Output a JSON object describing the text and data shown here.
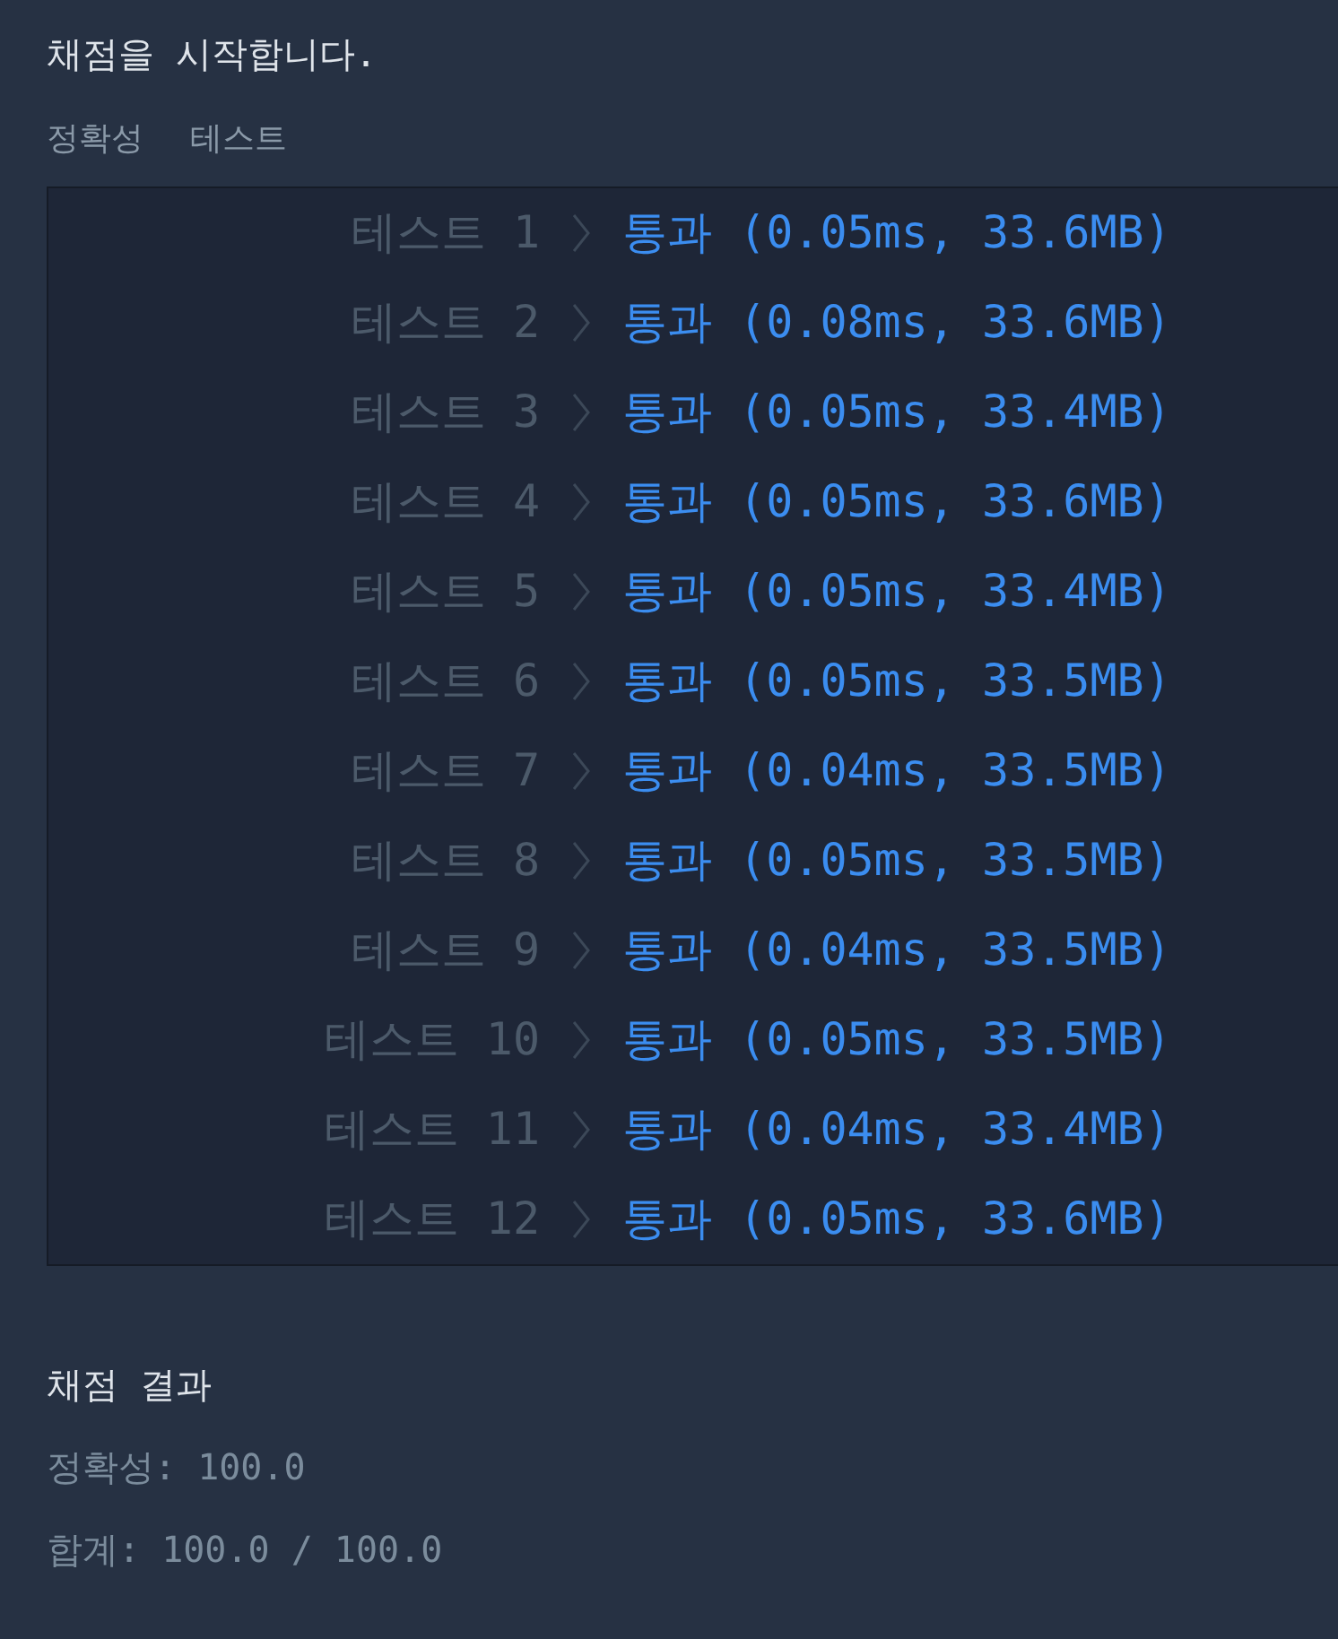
{
  "status_message": "채점을 시작합니다.",
  "tabs": [
    "정확성",
    "테스트"
  ],
  "results": [
    {
      "label": "테스트 1",
      "kind": "pass",
      "result": "통과 (0.05ms, 33.6MB)"
    },
    {
      "label": "테스트 2",
      "kind": "pass",
      "result": "통과 (0.08ms, 33.6MB)"
    },
    {
      "label": "테스트 3",
      "kind": "pass",
      "result": "통과 (0.05ms, 33.4MB)"
    },
    {
      "label": "테스트 4",
      "kind": "pass",
      "result": "통과 (0.05ms, 33.6MB)"
    },
    {
      "label": "테스트 5",
      "kind": "pass",
      "result": "통과 (0.05ms, 33.4MB)"
    },
    {
      "label": "테스트 6",
      "kind": "pass",
      "result": "통과 (0.05ms, 33.5MB)"
    },
    {
      "label": "테스트 7",
      "kind": "pass",
      "result": "통과 (0.04ms, 33.5MB)"
    },
    {
      "label": "테스트 8",
      "kind": "pass",
      "result": "통과 (0.05ms, 33.5MB)"
    },
    {
      "label": "테스트 9",
      "kind": "pass",
      "result": "통과 (0.04ms, 33.5MB)"
    },
    {
      "label": "테스트 10",
      "kind": "pass",
      "result": "통과 (0.05ms, 33.5MB)"
    },
    {
      "label": "테스트 11",
      "kind": "pass",
      "result": "통과 (0.04ms, 33.4MB)"
    },
    {
      "label": "테스트 12",
      "kind": "pass",
      "result": "통과 (0.05ms, 33.6MB)"
    }
  ],
  "summary": {
    "title": "채점 결과",
    "lines": [
      "정확성: 100.0",
      "합계: 100.0 / 100.0"
    ]
  }
}
